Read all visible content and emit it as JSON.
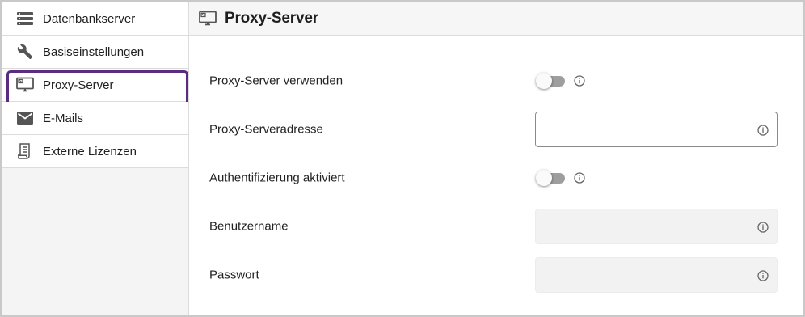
{
  "sidebar": {
    "items": [
      {
        "label": "Datenbankserver",
        "icon": "server-stack-icon"
      },
      {
        "label": "Basiseinstellungen",
        "icon": "wrench-icon"
      },
      {
        "label": "Proxy-Server",
        "icon": "monitor-icon",
        "active": true
      },
      {
        "label": "E-Mails",
        "icon": "envelope-icon"
      },
      {
        "label": "Externe Lizenzen",
        "icon": "license-document-icon"
      }
    ],
    "active_outline_color": "#5b2b82"
  },
  "header": {
    "title": "Proxy-Server",
    "icon": "monitor-icon"
  },
  "form": {
    "use_proxy": {
      "label": "Proxy-Server verwenden",
      "enabled": false
    },
    "proxy_address": {
      "label": "Proxy-Serveradresse",
      "value": ""
    },
    "auth_enabled": {
      "label": "Authentifizierung aktiviert",
      "enabled": false
    },
    "username": {
      "label": "Benutzername",
      "value": "",
      "disabled": true
    },
    "password": {
      "label": "Passwort",
      "value": "",
      "disabled": true
    }
  }
}
